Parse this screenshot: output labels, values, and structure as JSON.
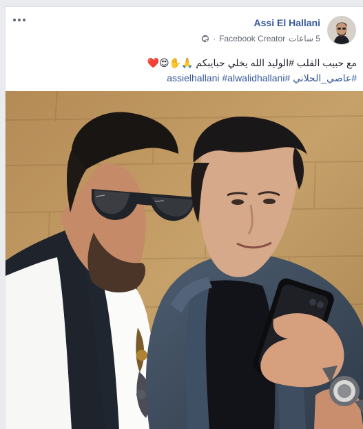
{
  "post": {
    "author": "Assi El Hallani",
    "time": "5 ساعات",
    "separator": "·",
    "audience_icon": "globe-icon",
    "source": "Facebook Creator",
    "more_icon": "three-dots-icon",
    "caption_text": "مع حبيب القلب #الوليد الله يخلي حبايبكم 🙏✋😍❤️",
    "hashtags": [
      "#alwalidhallani",
      "#assielhallani",
      "#عاصي_الحلاني"
    ],
    "photo_alt": "Two men taking a selfie with a phone in front of a stone wall"
  },
  "colors": {
    "link": "#365899",
    "text": "#1d2129",
    "meta": "#616770",
    "card_border": "#dddfe2",
    "page_bg": "#e9ebee"
  }
}
